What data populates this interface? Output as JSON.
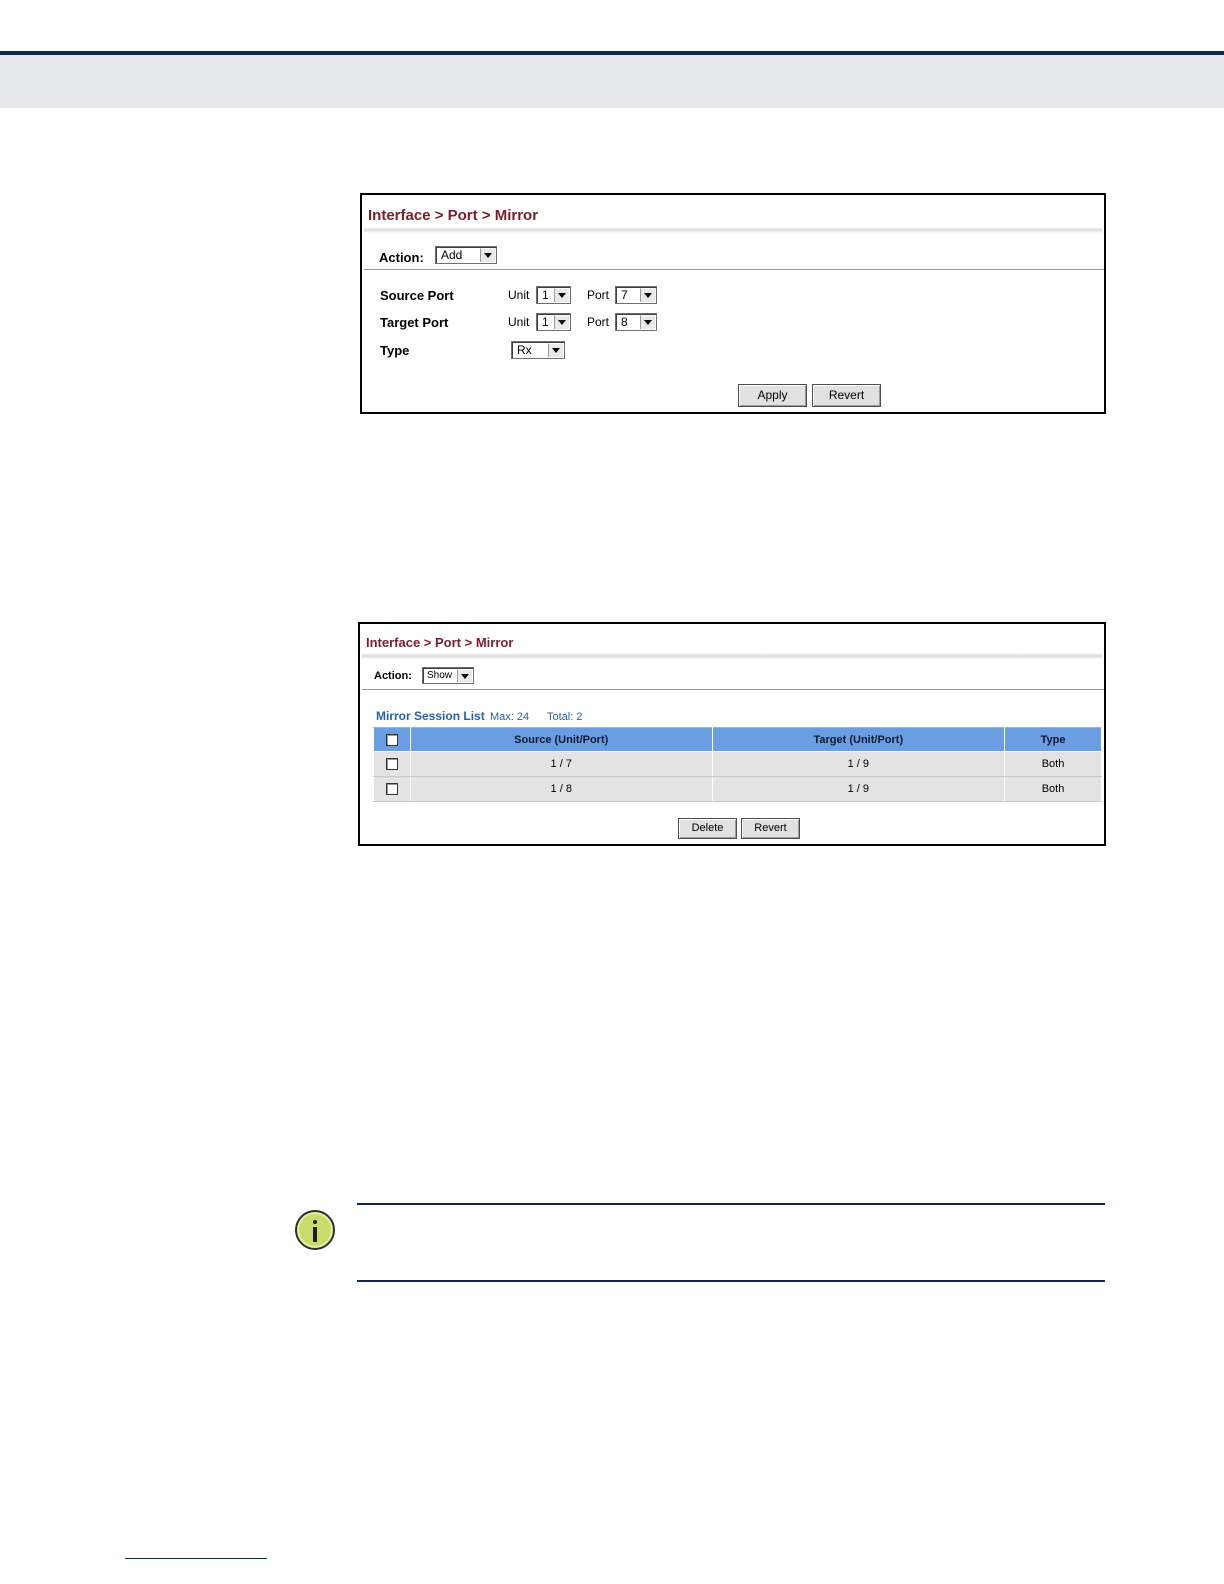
{
  "add_panel": {
    "breadcrumb": "Interface > Port > Mirror",
    "action_label": "Action:",
    "action_value": "Add",
    "source_port_label": "Source Port",
    "target_port_label": "Target Port",
    "type_label": "Type",
    "unit_label": "Unit",
    "port_label": "Port",
    "source_unit": "1",
    "source_port": "7",
    "target_unit": "1",
    "target_port": "8",
    "type_value": "Rx",
    "apply_label": "Apply",
    "revert_label": "Revert"
  },
  "show_panel": {
    "breadcrumb": "Interface > Port > Mirror",
    "action_label": "Action:",
    "action_value": "Show",
    "list_title": "Mirror Session List",
    "max_text": "Max: 24",
    "total_text": "Total: 2",
    "columns": [
      "Source (Unit/Port)",
      "Target (Unit/Port)",
      "Type"
    ],
    "rows": [
      {
        "source": "1 / 7",
        "target": "1 / 9",
        "type": "Both"
      },
      {
        "source": "1 / 8",
        "target": "1 / 9",
        "type": "Both"
      }
    ],
    "delete_label": "Delete",
    "revert_label": "Revert"
  },
  "colors": {
    "header_rule": "#17264f",
    "header_band": "#e6e8ed",
    "breadcrumb": "#7a1e2b",
    "table_header": "#6a9ee0",
    "list_title": "#2b5fa8",
    "note_icon": "#c9dc6b"
  },
  "icons": {
    "note": "info-icon"
  }
}
